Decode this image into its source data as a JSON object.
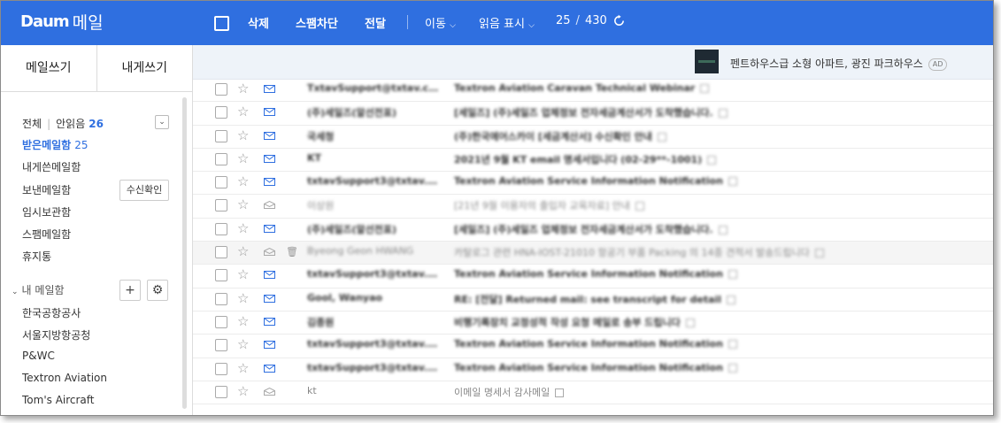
{
  "app": {
    "logo_mark": "Daum",
    "logo_text": "메일"
  },
  "toolbar": {
    "delete": "삭제",
    "spam": "스팸차단",
    "forward": "전달",
    "move": "이동",
    "mark_read": "읽음 표시",
    "current": "25",
    "total": "430"
  },
  "sidebar": {
    "compose": "메일쓰기",
    "compose_self": "내게쓰기",
    "all": "전체",
    "unread_label": "안읽음",
    "unread_count": "26",
    "folders": [
      {
        "label": "받은메일함",
        "count": "25"
      },
      {
        "label": "내게쓴메일함"
      },
      {
        "label": "보낸메일함"
      },
      {
        "label": "임시보관함"
      },
      {
        "label": "스팸메일함"
      },
      {
        "label": "휴지통"
      }
    ],
    "receipt_button": "수신확인",
    "my_mailbox": "내 메일함",
    "my_folders": [
      "한국공항공사",
      "서울지방항공청",
      "P&WC",
      "Textron Aviation",
      "Tom's Aircraft"
    ]
  },
  "ad": {
    "text": "펜트하우스급 소형 아파트, 광진 파크하우스",
    "badge": "AD"
  },
  "mails": [
    {
      "sender": "TxtavSupport@txtav.com",
      "subject": "Textron Aviation Caravan Technical Webinar",
      "read": false
    },
    {
      "sender": "(주)세일즈(알선전표)",
      "subject": "[세일즈] (주)세일즈 업체정보 전자세금계산서가 도착했습니다.",
      "read": false
    },
    {
      "sender": "국세청",
      "subject": "(주)한국에어스카이 [세금계산서] 수신확인 안내",
      "read": false
    },
    {
      "sender": "KT",
      "subject": "2021년 9월 KT email 명세서입니다 (02-29**-1001)",
      "read": false
    },
    {
      "sender": "txtavSupport3@txtav.c...",
      "subject": "Textron Aviation Service Information Notification",
      "read": false
    },
    {
      "sender": "이상원",
      "subject": "[21년 9월 이용자의 출입자 교육자료] 안내",
      "read": true
    },
    {
      "sender": "(주)세일즈(알선전표)",
      "subject": "[세일즈] (주)세일즈 업체정보 전자세금계산서가 도착했습니다.",
      "read": false
    },
    {
      "sender": "Byeong Geon HWANG",
      "subject": "카탈로그 관련 HNA-IOST-21010 항공기 부품 Packing 의 14종 견적서 발송드립니다",
      "read": true,
      "hl": true
    },
    {
      "sender": "txtavSupport3@txtav.c...",
      "subject": "Textron Aviation Service Information Notification",
      "read": false
    },
    {
      "sender": "Gool, Wanyao",
      "subject": "RE: [전달] Returned mail: see transcript for detail",
      "read": false
    },
    {
      "sender": "김종원",
      "subject": "비행기록장치 교정성적 작성 요청 메일로 송부 드립니다",
      "read": false
    },
    {
      "sender": "txtavSupport3@txtav.c...",
      "subject": "Textron Aviation Service Information Notification",
      "read": false
    },
    {
      "sender": "txtavSupport3@txtav.c...",
      "subject": "Textron Aviation Service Information Notification",
      "read": false
    },
    {
      "sender": "kt",
      "subject": "이메일 명세서 감사메일",
      "read": true,
      "clear": true
    }
  ],
  "colors": {
    "brand": "#2f6fe0",
    "ad_bg": "#eef3f9"
  }
}
